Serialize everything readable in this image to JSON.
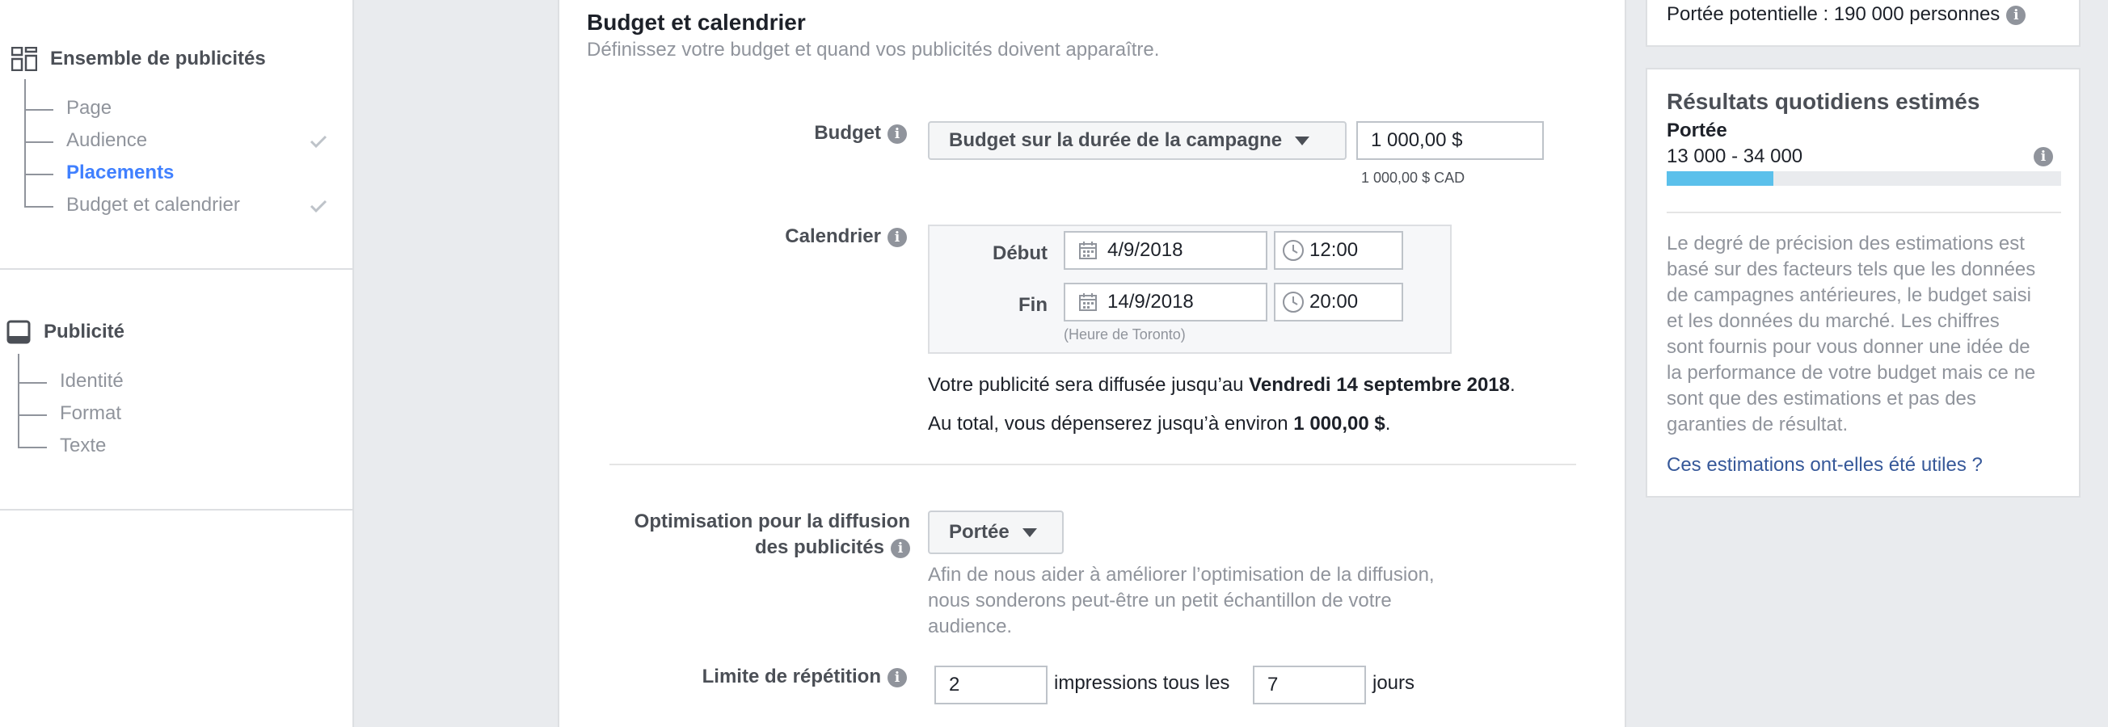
{
  "sidebar": {
    "adset": {
      "title": "Ensemble de publicités",
      "items": [
        {
          "label": "Page",
          "checked": false
        },
        {
          "label": "Audience",
          "checked": true
        },
        {
          "label": "Placements",
          "checked": false,
          "active": true
        },
        {
          "label": "Budget et calendrier",
          "checked": true
        }
      ]
    },
    "ad": {
      "title": "Publicité",
      "items": [
        {
          "label": "Identité"
        },
        {
          "label": "Format"
        },
        {
          "label": "Texte"
        }
      ]
    }
  },
  "main": {
    "title": "Budget et calendrier",
    "subtitle": "Définissez votre budget et quand vos publicités doivent apparaître.",
    "budget": {
      "label": "Budget",
      "type_label": "Budget sur la durée de la campagne",
      "amount": "1 000,00 $",
      "currency_note": "1 000,00 $ CAD"
    },
    "schedule": {
      "label": "Calendrier",
      "start_label": "Début",
      "start_date": "4/9/2018",
      "start_time": "12:00",
      "end_label": "Fin",
      "end_date": "14/9/2018",
      "end_time": "20:00",
      "tz_note": "(Heure de Toronto)"
    },
    "summary": {
      "line1_pre": "Votre publicité sera diffusée jusqu’au ",
      "line1_bold": "Vendredi 14 septembre 2018",
      "line1_post": ".",
      "line2_pre": "Au total, vous dépenserez jusqu’à environ ",
      "line2_bold": "1 000,00 $",
      "line2_post": "."
    },
    "optimization": {
      "label_line1": "Optimisation pour la diffusion",
      "label_line2": "des publicités",
      "value": "Portée",
      "help_line1": "Afin de nous aider à améliorer l’optimisation de la diffusion,",
      "help_line2": "nous sonderons peut-être un petit échantillon de votre",
      "help_line3": "audience."
    },
    "frequency": {
      "label": "Limite de répétition",
      "impressions": "2",
      "mid_text": "impressions tous les",
      "days": "7",
      "end_text": "jours"
    }
  },
  "right": {
    "potential_reach": "Portée potentielle : 190 000 personnes",
    "daily_title": "Résultats quotidiens estimés",
    "reach_label": "Portée",
    "reach_range": "13 000 - 34 000",
    "reach_bar_fraction": 0.27,
    "accent_color": "#5bc0eb",
    "disclaimer": [
      "Le degré de précision des estimations est",
      "basé sur des facteurs tels que les données",
      "de campagnes antérieures, le budget saisi",
      "et les données du marché. Les chiffres",
      "sont fournis pour vous donner une idée de",
      "la performance de votre budget mais ce ne",
      "sont que des estimations et pas des",
      "garanties de résultat."
    ],
    "feedback_link": "Ces estimations ont-elles été utiles ?"
  }
}
